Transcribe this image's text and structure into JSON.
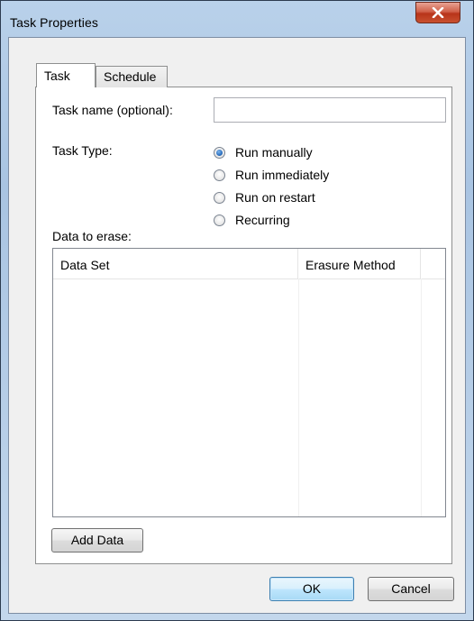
{
  "window": {
    "title": "Task Properties"
  },
  "tabs": [
    {
      "label": "Task",
      "selected": true
    },
    {
      "label": "Schedule",
      "selected": false
    }
  ],
  "task": {
    "name_label": "Task name (optional):",
    "name_value": "",
    "name_placeholder": "",
    "type_label": "Task Type:",
    "type_options": [
      {
        "label": "Run manually",
        "checked": true
      },
      {
        "label": "Run immediately",
        "checked": false
      },
      {
        "label": "Run on restart",
        "checked": false
      },
      {
        "label": "Recurring",
        "checked": false
      }
    ],
    "data_label": "Data to erase:",
    "columns": [
      "Data Set",
      "Erasure Method"
    ],
    "rows": [],
    "add_button": "Add Data"
  },
  "footer": {
    "ok": "OK",
    "cancel": "Cancel"
  },
  "colors": {
    "title_bar": "#b9d1ea",
    "close_button": "#c8502f",
    "radio_checked": "#2c6fbf",
    "ok_button_border": "#3c7fb1"
  },
  "icons": {
    "close": "close-icon"
  }
}
